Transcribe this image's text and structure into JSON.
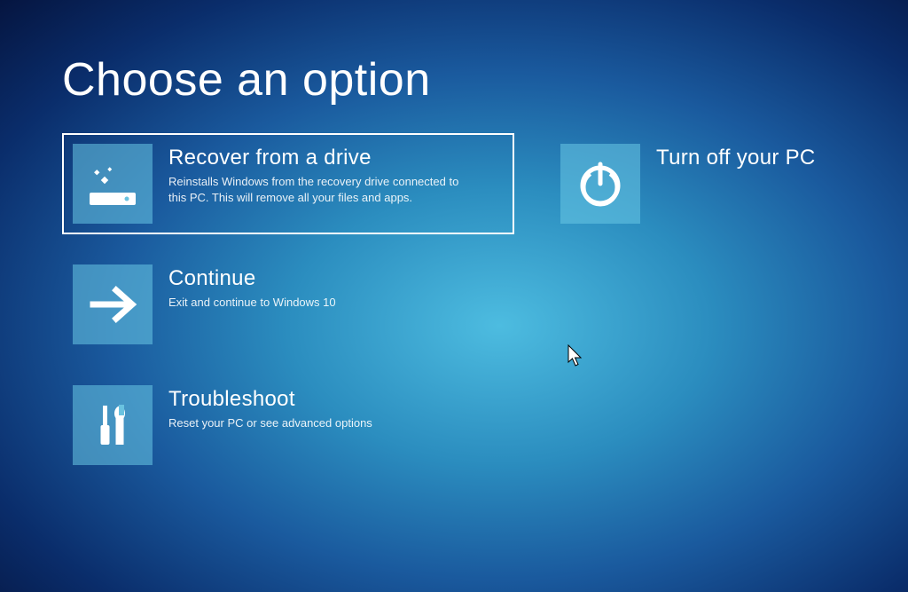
{
  "title": "Choose an option",
  "options": {
    "recover": {
      "title": "Recover from a drive",
      "desc": "Reinstalls Windows from the recovery drive connected to this PC. This will remove all your files and apps.",
      "icon": "recover-drive-icon",
      "selected": true
    },
    "turnoff": {
      "title": "Turn off your PC",
      "desc": "",
      "icon": "power-icon",
      "selected": false
    },
    "continue": {
      "title": "Continue",
      "desc": "Exit and continue to Windows 10",
      "icon": "arrow-right-icon",
      "selected": false
    },
    "troubleshoot": {
      "title": "Troubleshoot",
      "desc": "Reset your PC or see advanced options",
      "icon": "tools-icon",
      "selected": false
    }
  },
  "colors": {
    "tile_bg": "rgba(105,200,230,0.55)"
  }
}
